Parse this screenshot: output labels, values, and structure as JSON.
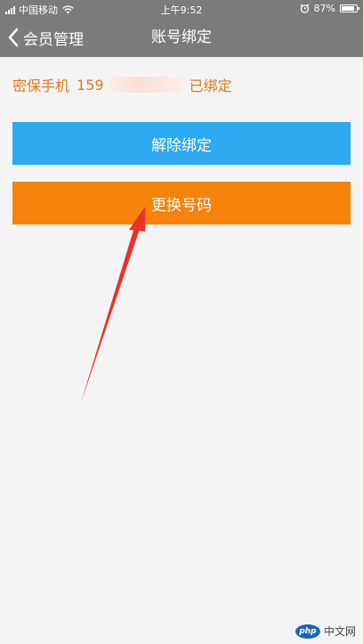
{
  "status_bar": {
    "carrier": "中国移动",
    "time": "上午9:52",
    "battery_percent_label": "87%",
    "battery_level": 0.87
  },
  "nav": {
    "back_label": "会员管理",
    "title": "账号绑定"
  },
  "phone_row": {
    "label": "密保手机",
    "prefix": "159",
    "status": "已绑定"
  },
  "buttons": {
    "unbind": "解除绑定",
    "change_number": "更换号码"
  },
  "watermark": {
    "logo_text": "php",
    "site_text": "中文网"
  },
  "colors": {
    "header_bg": "#7b7b7b",
    "accent_text": "#e07a1f",
    "unbind_bg": "#2eaaf0",
    "change_bg": "#f7820c",
    "annotation_arrow": "#e8322a"
  },
  "icons": {
    "back": "chevron-left-icon",
    "wifi": "wifi-icon",
    "alarm": "alarm-icon",
    "battery": "battery-icon",
    "signal": "signal-icon"
  }
}
